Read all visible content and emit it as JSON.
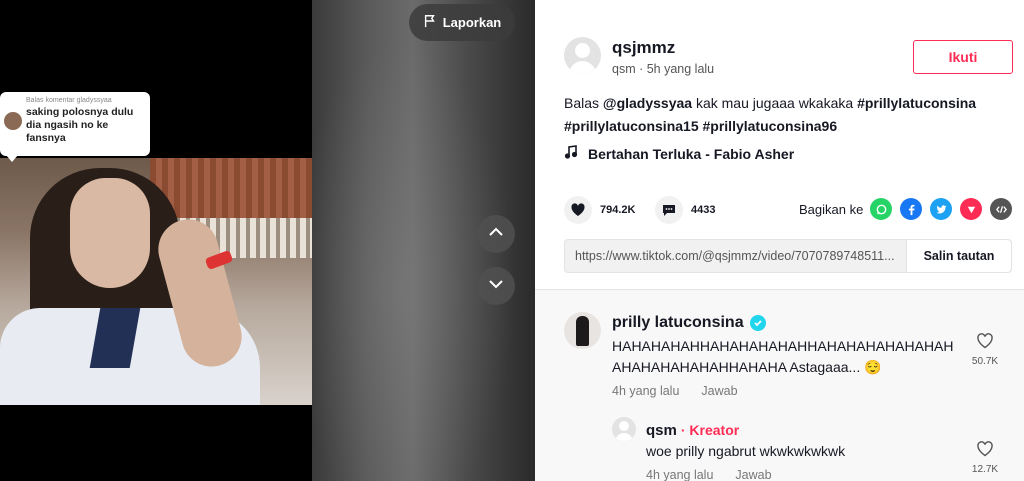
{
  "video": {
    "report_label": "Laporkan",
    "reply_bubble": {
      "title": "Balas komentar gladyssyaa",
      "text": "saking polosnya dulu dia ngasih no ke fansnya"
    }
  },
  "author": {
    "username": "qsjmmz",
    "meta": "qsm · 5h yang lalu",
    "follow_label": "Ikuti"
  },
  "caption": {
    "prefix": "Balas ",
    "mention": "@gladyssyaa",
    "text": " kak mau jugaaa wkakaka ",
    "tag1": "#prillylatuconsina",
    "tag2": "#prillylatuconsina15",
    "tag3": "#prillylatuconsina96"
  },
  "music": "Bertahan Terluka - Fabio Asher",
  "stats": {
    "likes": "794.2K",
    "comments": "4433"
  },
  "share": {
    "label": "Bagikan ke",
    "icons": [
      "whatsapp-icon",
      "facebook-icon",
      "twitter-icon",
      "pinterest-icon",
      "embed-icon"
    ]
  },
  "link": {
    "url": "https://www.tiktok.com/@qsjmmz/video/7070789748511...",
    "copy_label": "Salin tautan"
  },
  "comments": [
    {
      "name": "prilly latuconsina",
      "text": "HAHAHAHAHHAHAHAHAHAHHAHAHAHAHAHAHAHAHAHAHAHAHAHHAHAHA Astagaaa... 😌",
      "time": "4h yang lalu",
      "reply_label": "Jawab",
      "likes": "50.7K"
    },
    {
      "name": "qsm",
      "creator_label": "· Kreator",
      "text": "woe prilly ngabrut wkwkwkwkwk",
      "time": "4h yang lalu",
      "reply_label": "Jawab",
      "likes": "12.7K"
    }
  ],
  "colors": {
    "accent": "#fe2c55",
    "verified": "#20d5ec"
  }
}
